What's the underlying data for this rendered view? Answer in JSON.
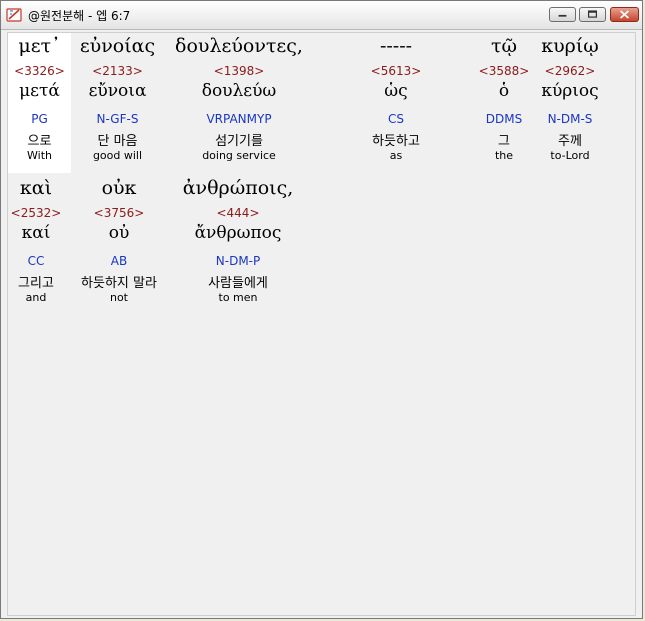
{
  "window": {
    "title": "@원전분해 - 엡 6:7",
    "controls": [
      "minimize",
      "maximize",
      "close"
    ]
  },
  "rows": [
    {
      "words": [
        {
          "surface": "μετ᾽",
          "strong": "<3326>",
          "lemma": "μετά",
          "morph": "PG",
          "korean": "으로",
          "english": "With"
        },
        {
          "surface": "εὐνοίας",
          "strong": "<2133>",
          "lemma": "εὔνοια",
          "morph": "N-GF-S",
          "korean": "단 마음",
          "english": "good will"
        },
        {
          "surface": "δουλεύοντες,",
          "strong": "<1398>",
          "lemma": "δουλεύω",
          "morph": "VRPANMYP",
          "korean": "섬기기를",
          "english": "doing service"
        },
        {
          "surface": "-----",
          "strong": "<5613>",
          "lemma": "ὡς",
          "morph": "CS",
          "korean": "하듯하고",
          "english": "as"
        },
        {
          "surface": "τῷ",
          "strong": "<3588>",
          "lemma": "ὁ",
          "morph": "DDMS",
          "korean": "그",
          "english": "the"
        },
        {
          "surface": "κυρίῳ",
          "strong": "<2962>",
          "lemma": "κύριος",
          "morph": "N-DM-S",
          "korean": "주께",
          "english": "to-Lord"
        }
      ]
    },
    {
      "words": [
        {
          "surface": "καὶ",
          "strong": "<2532>",
          "lemma": "καί",
          "morph": "CC",
          "korean": "그리고",
          "english": "and"
        },
        {
          "surface": "οὐκ",
          "strong": "<3756>",
          "lemma": "οὐ",
          "morph": "AB",
          "korean": "하듯하지 말라",
          "english": "not"
        },
        {
          "surface": "ἀνθρώποις,",
          "strong": "<444>",
          "lemma": "ἄνθρωπος",
          "morph": "N-DM-P",
          "korean": "사람들에게",
          "english": "to men"
        }
      ]
    }
  ],
  "colors": {
    "strong": "#8b1a1a",
    "morph": "#1a36c4",
    "text": "#000000",
    "selected_background": "#ffffff"
  }
}
